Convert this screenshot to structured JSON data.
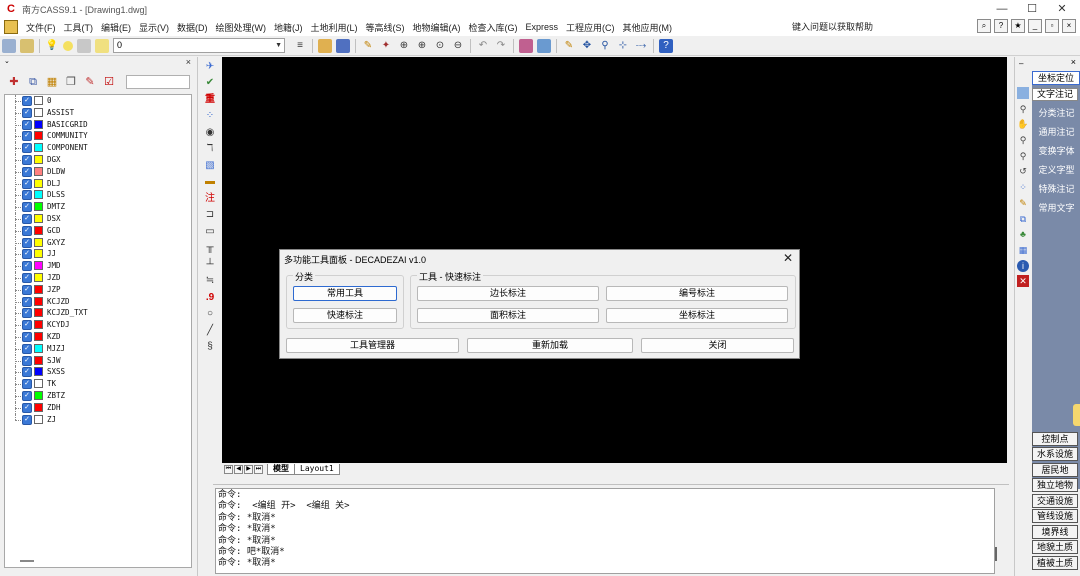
{
  "window": {
    "title": "南方CASS9.1 - [Drawing1.dwg]",
    "logo": "C",
    "min": "—",
    "max": "☐",
    "close": "✕"
  },
  "menu": {
    "items": [
      "文件(F)",
      "工具(T)",
      "编辑(E)",
      "显示(V)",
      "数据(D)",
      "绘图处理(W)",
      "地籍(J)",
      "土地利用(L)",
      "等高线(S)",
      "地物编辑(A)",
      "检查入库(G)",
      "Express",
      "工程应用(C)",
      "其他应用(M)"
    ],
    "help_hint": "键入问题以获取帮助"
  },
  "toolbar": {
    "layer_value": "0"
  },
  "layers": [
    {
      "name": "0",
      "color": "#ffffff"
    },
    {
      "name": "ASSIST",
      "color": "#ffffff"
    },
    {
      "name": "BASICGRID",
      "color": "#0000ff"
    },
    {
      "name": "COMMUNITY",
      "color": "#ff0000"
    },
    {
      "name": "COMPONENT",
      "color": "#00ffff"
    },
    {
      "name": "DGX",
      "color": "#ffff00"
    },
    {
      "name": "DLDW",
      "color": "#ff8080"
    },
    {
      "name": "DLJ",
      "color": "#ffff00"
    },
    {
      "name": "DLSS",
      "color": "#00ffff"
    },
    {
      "name": "DMTZ",
      "color": "#00ff00"
    },
    {
      "name": "DSX",
      "color": "#ffff00"
    },
    {
      "name": "GCD",
      "color": "#ff0000"
    },
    {
      "name": "GXYZ",
      "color": "#ffff00"
    },
    {
      "name": "JJ",
      "color": "#ffff00"
    },
    {
      "name": "JMD",
      "color": "#ff00ff"
    },
    {
      "name": "JZD",
      "color": "#ffff00"
    },
    {
      "name": "JZP",
      "color": "#ff0000"
    },
    {
      "name": "KCJZD",
      "color": "#ff0000"
    },
    {
      "name": "KCJZD_TXT",
      "color": "#ff0000"
    },
    {
      "name": "KCYDJ",
      "color": "#ff0000"
    },
    {
      "name": "KZD",
      "color": "#ff0000"
    },
    {
      "name": "MJZJ",
      "color": "#00ffff"
    },
    {
      "name": "SJW",
      "color": "#ff0000"
    },
    {
      "name": "SXSS",
      "color": "#0000ff"
    },
    {
      "name": "TK",
      "color": "#ffffff"
    },
    {
      "name": "ZBTZ",
      "color": "#00ff00"
    },
    {
      "name": "ZDH",
      "color": "#ff0000"
    },
    {
      "name": "ZJ",
      "color": "#ffffff"
    }
  ],
  "tabs": [
    "模型",
    "Layout1"
  ],
  "command_lines": [
    "命令:",
    "命令:  <编组 开>  <编组 关>",
    "命令: *取消*",
    "命令: *取消*",
    "命令: *取消*",
    "命令: 吧*取消*",
    "命令: *取消*"
  ],
  "right_panel": {
    "top_button": "坐标定位",
    "second_button": "文字注记",
    "items": [
      "分类注记",
      "通用注记",
      "变换字体",
      "定义字型",
      "特殊注记",
      "常用文字"
    ],
    "bottom_buttons": [
      "控制点",
      "水系设施",
      "居民地",
      "独立地物",
      "交通设施",
      "管线设施",
      "境界线",
      "地貌土质",
      "植被土质"
    ]
  },
  "dialog": {
    "title": "多功能工具面板 - DECADEZAI v1.0",
    "close": "✕",
    "group_category": "分类",
    "group_tools": "工具 - 快速标注",
    "btn_common_tools": "常用工具",
    "btn_quick_label": "快速标注",
    "btn_side_length": "边长标注",
    "btn_number": "编号标注",
    "btn_area": "面积标注",
    "btn_coord": "坐标标注",
    "btn_tool_manager": "工具管理器",
    "btn_reload": "重新加载",
    "btn_close": "关闭"
  }
}
